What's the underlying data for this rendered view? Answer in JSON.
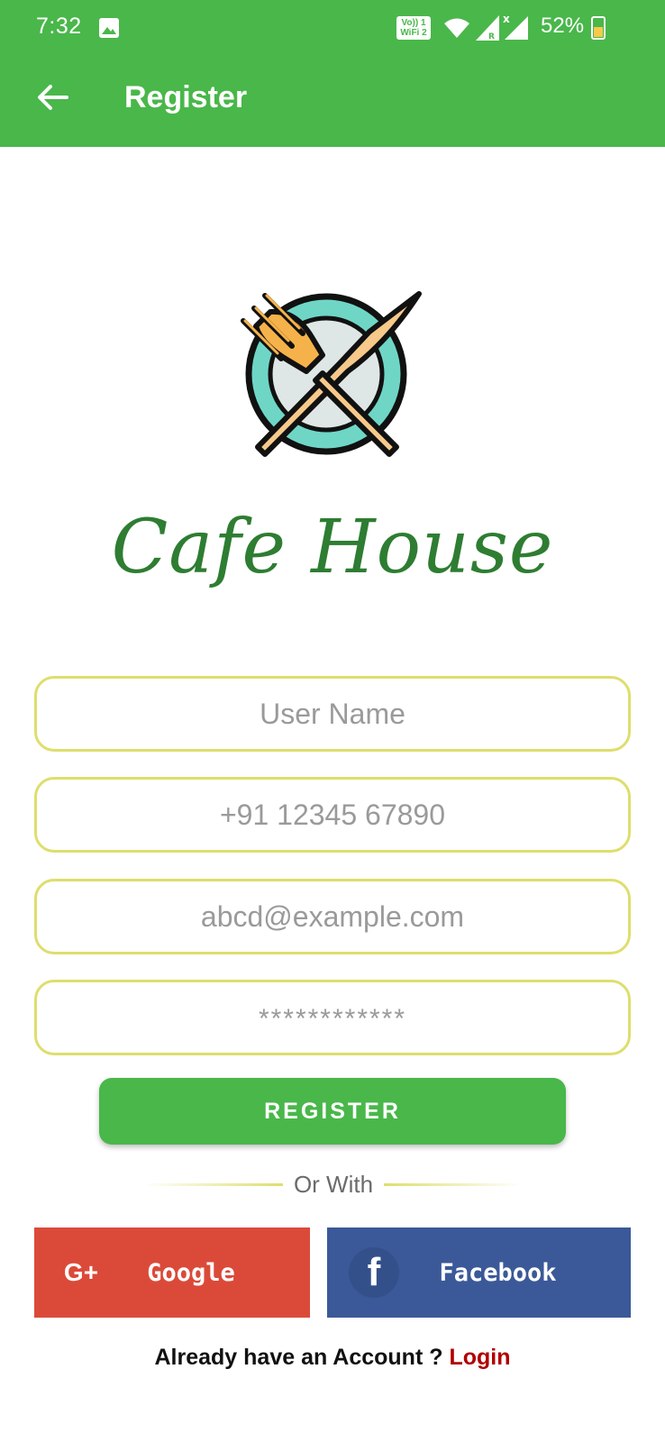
{
  "status_bar": {
    "time": "7:32",
    "network_badge_top": "Vo)) 1",
    "network_badge_bottom": "WiFi 2",
    "battery": "52%",
    "icons": [
      "image-icon",
      "wifi-icon",
      "signal-icon",
      "signal-x-icon",
      "battery-icon"
    ]
  },
  "app_bar": {
    "title": "Register",
    "back_icon": "arrow-left-icon"
  },
  "brand": {
    "name": "Cafe House",
    "logo": "plate-fork-knife-logo"
  },
  "form": {
    "username_placeholder": "User Name",
    "phone_placeholder": "+91 12345 67890",
    "email_placeholder": "abcd@example.com",
    "password_placeholder": "************",
    "register_label": "REGISTER",
    "or_with": "Or With"
  },
  "social": {
    "google_label": "Google",
    "google_icon": "G+",
    "facebook_label": "Facebook",
    "facebook_icon": "f"
  },
  "footer": {
    "prompt": "Already have an Account ? ",
    "login_label": "Login"
  },
  "colors": {
    "primary": "#49b74a",
    "field_border": "#dede6d",
    "google": "#db4a39",
    "facebook": "#3b5998",
    "login_link": "#b00000",
    "brand_text": "#2e7d32"
  }
}
